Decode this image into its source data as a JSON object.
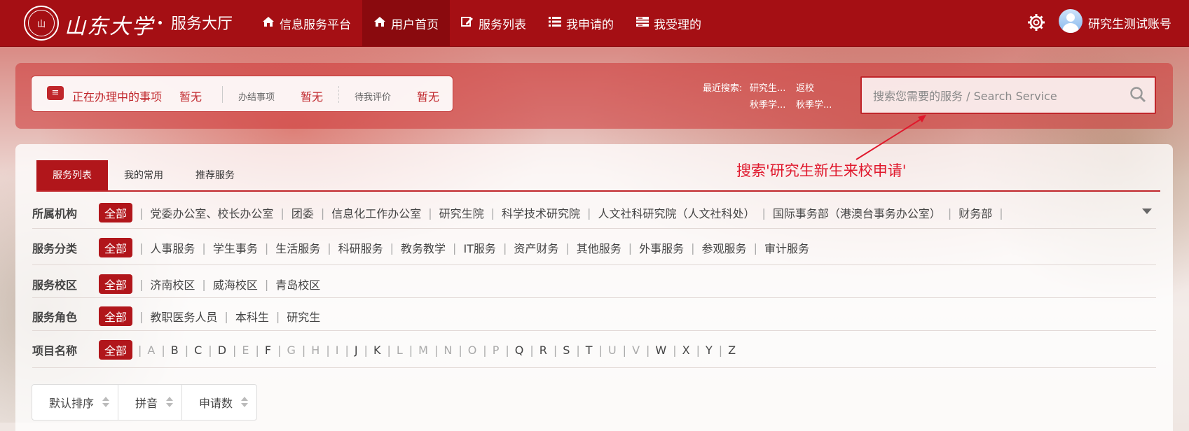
{
  "header": {
    "logo_text": "山东大学",
    "brand": "山东大学",
    "hall": "服务大厅",
    "nav": [
      {
        "label": "信息服务平台",
        "icon": "home-icon"
      },
      {
        "label": "用户首页",
        "icon": "home-icon"
      },
      {
        "label": "服务列表",
        "icon": "edit-icon"
      },
      {
        "label": "我申请的",
        "icon": "list-icon"
      },
      {
        "label": "我受理的",
        "icon": "inbox-icon"
      }
    ],
    "active_nav": "用户首页",
    "username": "研究生测试账号"
  },
  "status": {
    "processing_label": "正在办理中的事项",
    "processing_value": "暂无",
    "done_label": "办结事项",
    "done_value": "暂无",
    "rate_label": "待我评价",
    "rate_value": "暂无"
  },
  "recent": {
    "label": "最近搜索:",
    "items": [
      "研究生...",
      "返校",
      "秋季学...",
      "秋季学..."
    ]
  },
  "search": {
    "placeholder": "搜索您需要的服务 / Search Service",
    "value": ""
  },
  "annotation": "搜索'研究生新生来校申请'",
  "tabs": [
    "服务列表",
    "我的常用",
    "推荐服务"
  ],
  "filters": {
    "all": "全部",
    "org": {
      "label": "所属机构",
      "options": [
        "党委办公室、校长办公室",
        "团委",
        "信息化工作办公室",
        "研究生院",
        "科学技术研究院",
        "人文社科研究院（人文社科处）",
        "国际事务部（港澳台事务办公室）",
        "财务部"
      ]
    },
    "category": {
      "label": "服务分类",
      "options": [
        "人事服务",
        "学生事务",
        "生活服务",
        "科研服务",
        "教务教学",
        "IT服务",
        "资产财务",
        "其他服务",
        "外事服务",
        "参观服务",
        "审计服务"
      ]
    },
    "campus": {
      "label": "服务校区",
      "options": [
        "济南校区",
        "威海校区",
        "青岛校区"
      ]
    },
    "role": {
      "label": "服务角色",
      "options": [
        "教职医务人员",
        "本科生",
        "研究生"
      ]
    },
    "name": {
      "label": "项目名称",
      "letters": [
        "A",
        "B",
        "C",
        "D",
        "E",
        "F",
        "G",
        "H",
        "I",
        "J",
        "K",
        "L",
        "M",
        "N",
        "O",
        "P",
        "Q",
        "R",
        "S",
        "T",
        "U",
        "V",
        "W",
        "X",
        "Y",
        "Z"
      ],
      "dim_letters": [
        "A",
        "E",
        "G",
        "H",
        "I",
        "L",
        "M",
        "N",
        "O",
        "P",
        "U",
        "V"
      ]
    }
  },
  "sort": [
    "默认排序",
    "拼音",
    "申请数"
  ]
}
